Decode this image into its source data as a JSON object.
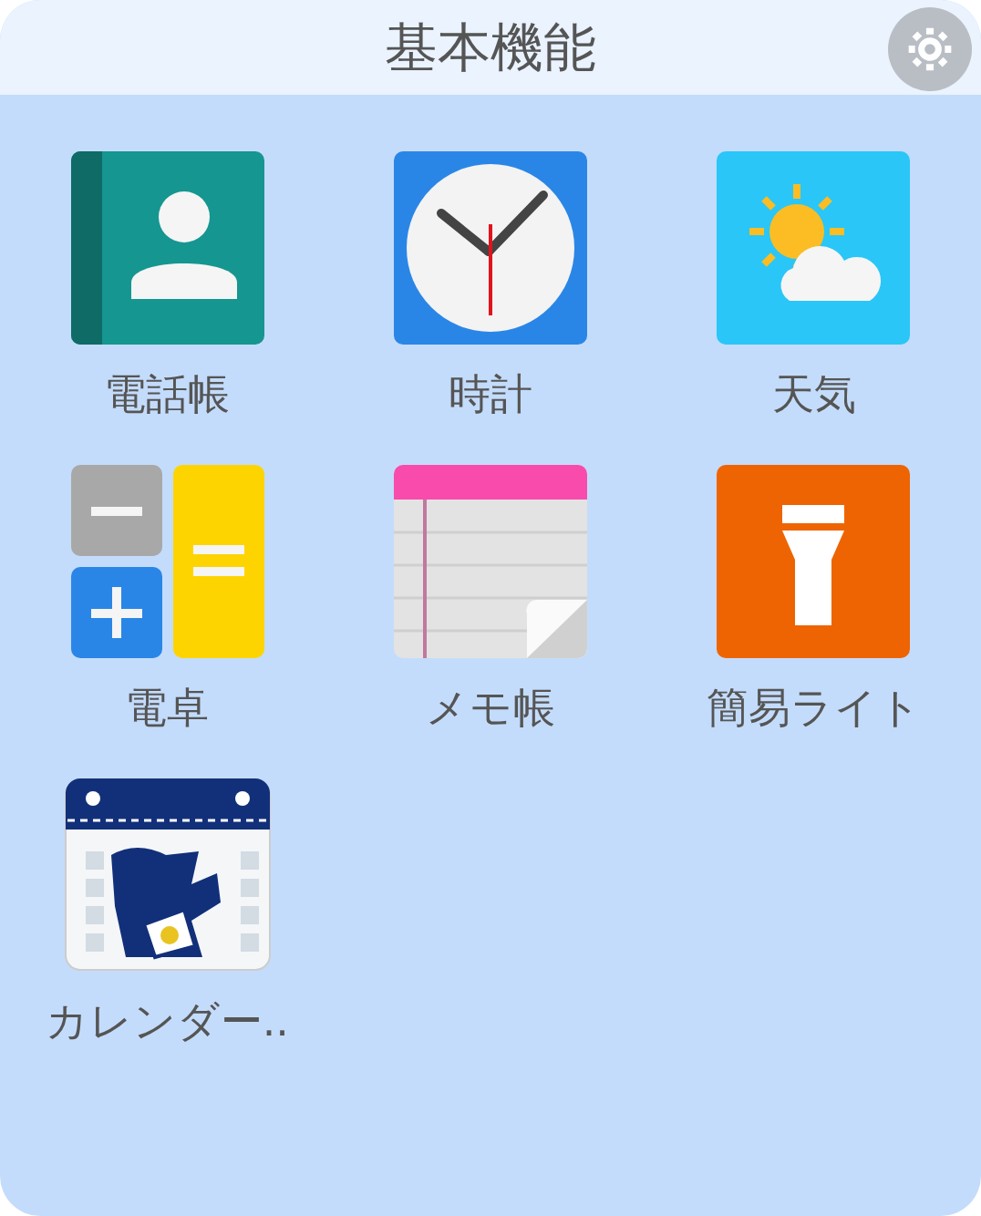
{
  "header": {
    "title": "基本機能"
  },
  "apps": [
    {
      "label": "電話帳",
      "kind": "contacts"
    },
    {
      "label": "時計",
      "kind": "clock"
    },
    {
      "label": "天気",
      "kind": "weather"
    },
    {
      "label": "電卓",
      "kind": "calculator"
    },
    {
      "label": "メモ帳",
      "kind": "memo"
    },
    {
      "label": "簡易ライト",
      "kind": "flashlight"
    },
    {
      "label": "カレンダー..",
      "kind": "calendar"
    }
  ]
}
